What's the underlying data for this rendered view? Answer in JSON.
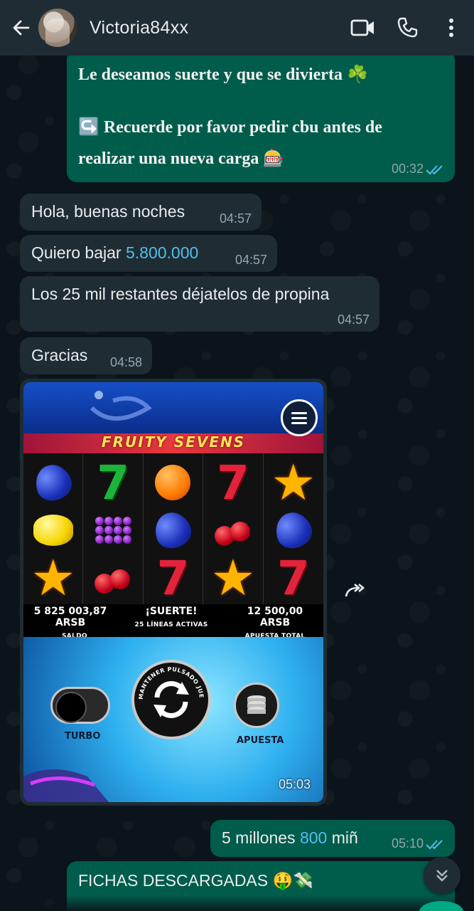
{
  "header": {
    "contact_name": "Victoria84xx",
    "icons": [
      "back-arrow-icon",
      "avatar",
      "video-call-icon",
      "phone-icon",
      "more-vert-icon"
    ]
  },
  "messages": [
    {
      "direction": "out",
      "lines": [
        "Le deseamos suerte y que se divierta ☘️",
        "↪️ Recuerde por favor pedir cbu antes de",
        "realizar una nueva carga 🎰"
      ],
      "time": "00:32",
      "status": "read"
    },
    {
      "direction": "in",
      "text": "Hola, buenas noches",
      "time": "04:57"
    },
    {
      "direction": "in",
      "text_before": "Quiero bajar ",
      "link_number": "5.800.000",
      "time": "04:57"
    },
    {
      "direction": "in",
      "text": "Los 25 mil restantes déjatelos de propina",
      "time": "04:57"
    },
    {
      "direction": "in",
      "text": "Gracias",
      "time": "04:58"
    },
    {
      "direction": "in",
      "type": "image",
      "time": "05:03",
      "game": {
        "title": "FRUITY SEVENS",
        "reels": [
          [
            "plum",
            "seven-green",
            "orange",
            "seven-red",
            "star"
          ],
          [
            "lemon",
            "grapes",
            "plum",
            "cherry",
            "plum"
          ],
          [
            "star",
            "cherry",
            "seven-red",
            "star",
            "seven-red"
          ]
        ],
        "saldo_value": "5 825 003,87 ARSB",
        "saldo_label": "SALDO",
        "suerte_value": "¡SUERTE!",
        "suerte_label": "25 LÍNEAS ACTIVAS",
        "apuesta_value": "12 500,00 ARSB",
        "apuesta_label": "APUESTA TOTAL",
        "turbo_label": "TURBO",
        "spin_ring_text": "MANTENER PULSADO JUEGO AUTO",
        "bet_label": "APUESTA"
      }
    },
    {
      "direction": "out",
      "text_before": "5 millones ",
      "link_number": "800",
      "text_after": " miñ",
      "time": "05:10",
      "status": "read"
    },
    {
      "direction": "out",
      "text": "FICHAS DESCARGADAS 🤑💸"
    }
  ],
  "colors": {
    "outgoing_bubble": "#005c4b",
    "incoming_bubble": "#1f2c34",
    "header": "#1f2c34",
    "read_ticks": "#53bdeb",
    "link_number": "#53bdeb"
  }
}
